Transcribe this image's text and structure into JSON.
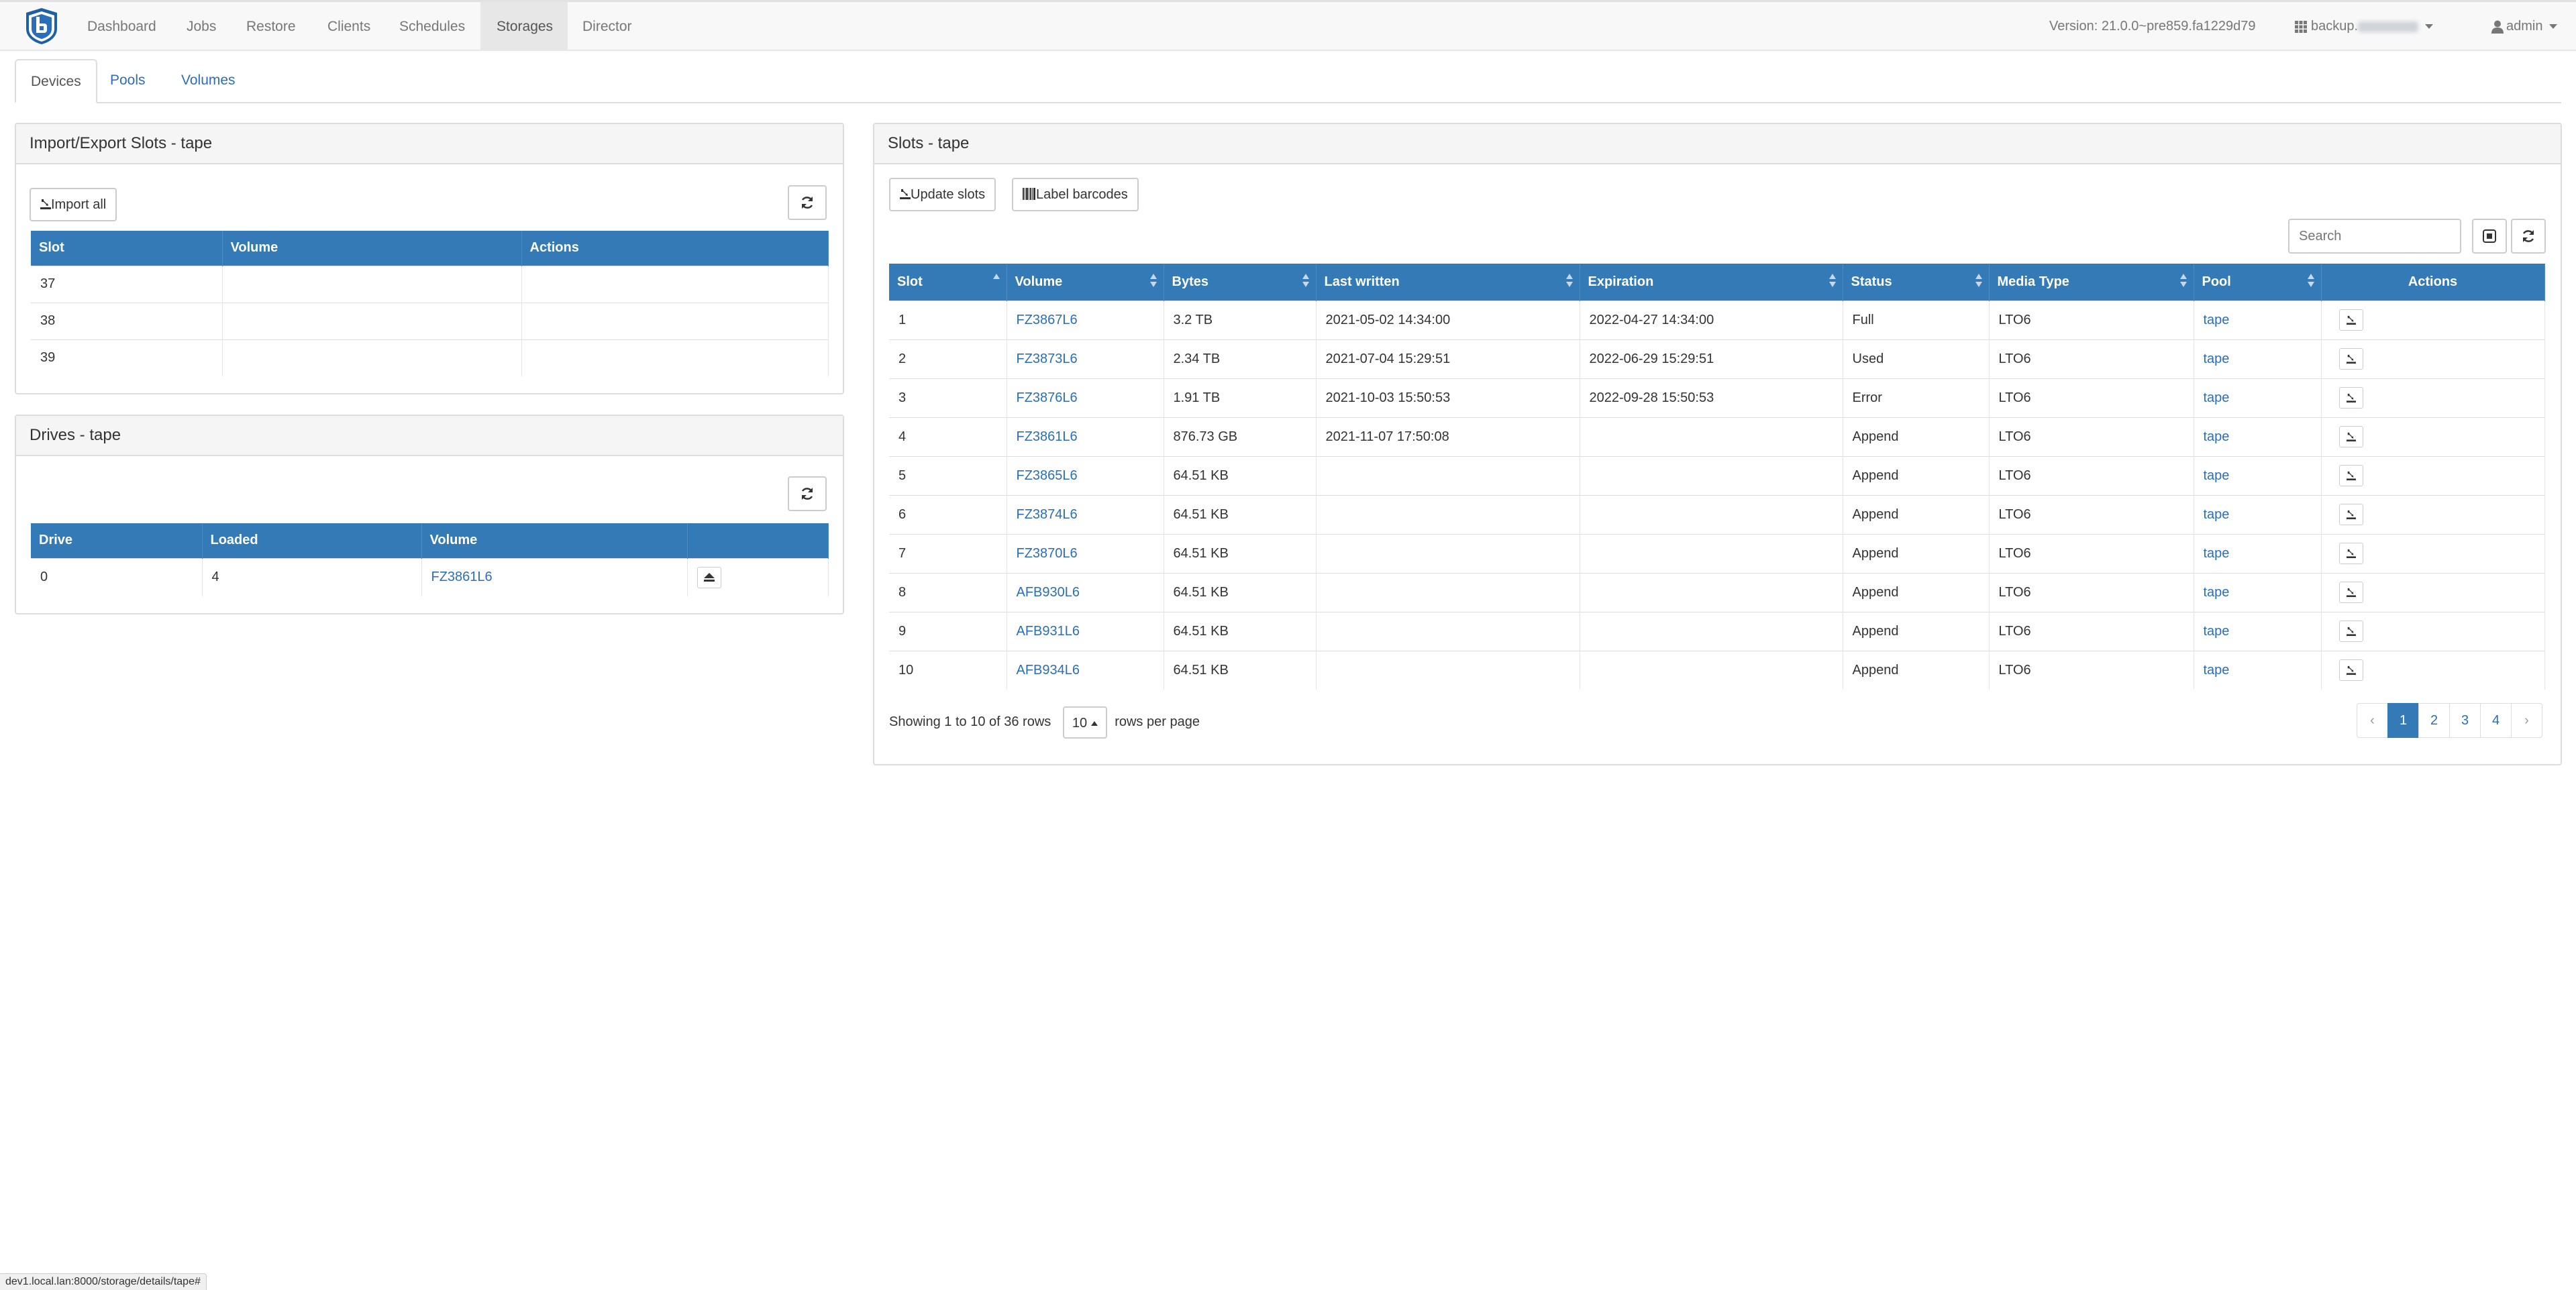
{
  "nav": {
    "items": [
      "Dashboard",
      "Jobs",
      "Restore",
      "Clients",
      "Schedules",
      "Storages",
      "Director"
    ],
    "version": "Version: 21.0.0~pre859.fa1229d79",
    "director_prefix": "backup.",
    "user": "admin"
  },
  "subtabs": [
    "Devices",
    "Pools",
    "Volumes"
  ],
  "import_export": {
    "title": "Import/Export Slots - tape",
    "import_all": "Import all",
    "headers": [
      "Slot",
      "Volume",
      "Actions"
    ],
    "rows": [
      [
        "37",
        "",
        ""
      ],
      [
        "38",
        "",
        ""
      ],
      [
        "39",
        "",
        ""
      ]
    ]
  },
  "drives": {
    "title": "Drives - tape",
    "headers": [
      "Drive",
      "Loaded",
      "Volume"
    ],
    "rows": [
      [
        "0",
        "4",
        "FZ3861L6"
      ]
    ]
  },
  "slots": {
    "title": "Slots - tape",
    "update_slots": "Update slots",
    "label_barcodes": "Label barcodes",
    "search_placeholder": "Search",
    "headers": [
      "Slot",
      "Volume",
      "Bytes",
      "Last written",
      "Expiration",
      "Status",
      "Media Type",
      "Pool",
      "Actions"
    ],
    "rows": [
      [
        "1",
        "FZ3867L6",
        "3.2 TB",
        "2021-05-02 14:34:00",
        "2022-04-27 14:34:00",
        "Full",
        "LTO6",
        "tape"
      ],
      [
        "2",
        "FZ3873L6",
        "2.34 TB",
        "2021-07-04 15:29:51",
        "2022-06-29 15:29:51",
        "Used",
        "LTO6",
        "tape"
      ],
      [
        "3",
        "FZ3876L6",
        "1.91 TB",
        "2021-10-03 15:50:53",
        "2022-09-28 15:50:53",
        "Error",
        "LTO6",
        "tape"
      ],
      [
        "4",
        "FZ3861L6",
        "876.73 GB",
        "2021-11-07 17:50:08",
        "",
        "Append",
        "LTO6",
        "tape"
      ],
      [
        "5",
        "FZ3865L6",
        "64.51 KB",
        "",
        "",
        "Append",
        "LTO6",
        "tape"
      ],
      [
        "6",
        "FZ3874L6",
        "64.51 KB",
        "",
        "",
        "Append",
        "LTO6",
        "tape"
      ],
      [
        "7",
        "FZ3870L6",
        "64.51 KB",
        "",
        "",
        "Append",
        "LTO6",
        "tape"
      ],
      [
        "8",
        "AFB930L6",
        "64.51 KB",
        "",
        "",
        "Append",
        "LTO6",
        "tape"
      ],
      [
        "9",
        "AFB931L6",
        "64.51 KB",
        "",
        "",
        "Append",
        "LTO6",
        "tape"
      ],
      [
        "10",
        "AFB934L6",
        "64.51 KB",
        "",
        "",
        "Append",
        "LTO6",
        "tape"
      ]
    ],
    "showing": "Showing 1 to 10 of 36 rows",
    "page_size": "10",
    "rows_per_page": "rows per page",
    "pages": [
      "‹",
      "1",
      "2",
      "3",
      "4",
      "›"
    ]
  },
  "statusbar": "dev1.local.lan:8000/storage/details/tape#",
  "colors": {
    "primary": "#337ab7",
    "link": "#2a6ebb"
  }
}
